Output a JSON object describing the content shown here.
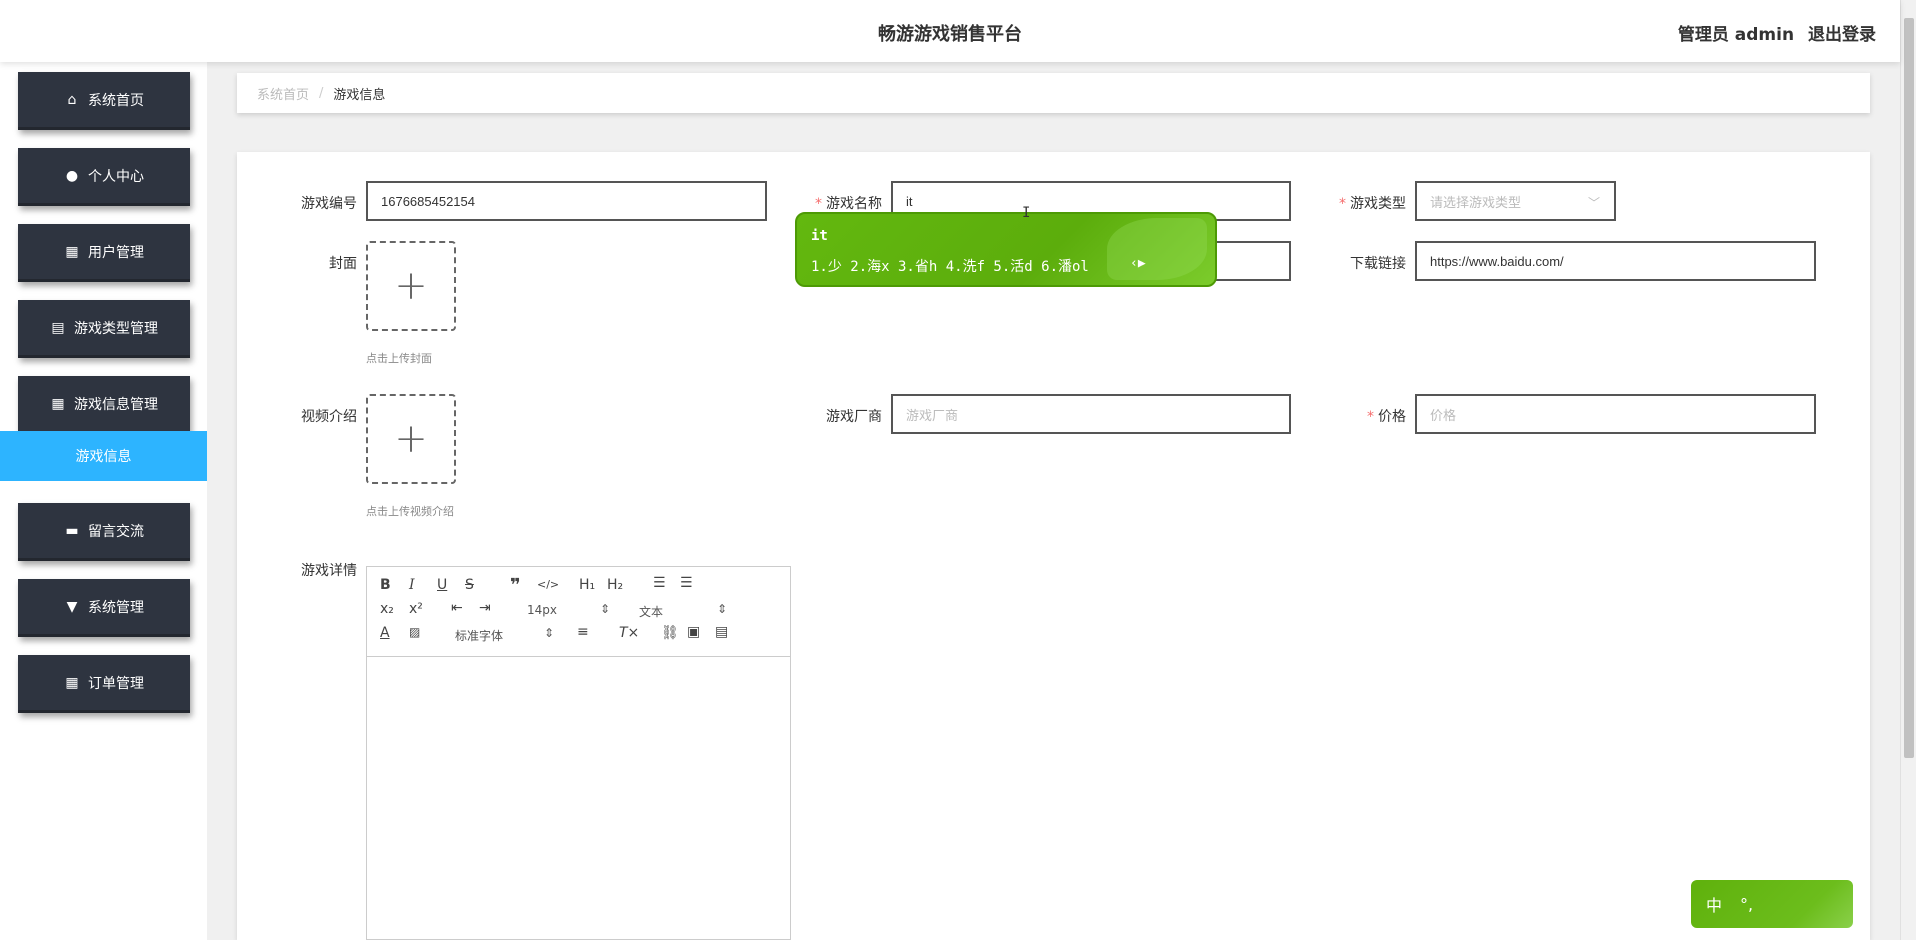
{
  "header": {
    "title": "畅游游戏销售平台",
    "user_label": "管理员 admin",
    "logout_label": "退出登录"
  },
  "sidebar": {
    "items": [
      {
        "label": "系统首页",
        "icon": "home-icon"
      },
      {
        "label": "个人中心",
        "icon": "user-icon"
      },
      {
        "label": "用户管理",
        "icon": "grid-icon"
      },
      {
        "label": "游戏类型管理",
        "icon": "clipboard-icon"
      },
      {
        "label": "游戏信息管理",
        "icon": "table-icon"
      },
      {
        "label": "留言交流",
        "icon": "chat-icon"
      },
      {
        "label": "系统管理",
        "icon": "settings-icon"
      },
      {
        "label": "订单管理",
        "icon": "grid-icon"
      }
    ],
    "active_sub": "游戏信息"
  },
  "breadcrumb": {
    "home": "系统首页",
    "separator": "/",
    "current": "游戏信息"
  },
  "form": {
    "game_no": {
      "label": "游戏编号",
      "value": "1676685452154"
    },
    "game_name": {
      "label": "游戏名称",
      "value": "it"
    },
    "game_type": {
      "label": "游戏类型",
      "placeholder": "请选择游戏类型"
    },
    "cover": {
      "label": "封面",
      "hint": "点击上传封面"
    },
    "download": {
      "label": "下载链接",
      "value": "https://www.baidu.com/"
    },
    "video": {
      "label": "视频介绍",
      "hint": "点击上传视频介绍"
    },
    "vendor": {
      "label": "游戏厂商",
      "placeholder": "游戏厂商"
    },
    "price": {
      "label": "价格",
      "placeholder": "价格"
    },
    "detail": {
      "label": "游戏详情"
    }
  },
  "editor": {
    "font_size": "14px",
    "text_style": "文本",
    "font_family": "标准字体"
  },
  "ime": {
    "composition": "it",
    "candidates": "1.少 2.海x 3.省h 4.洗f 5.活d 6.潘ol",
    "status_mode": "中",
    "status_punct": "°,"
  },
  "colors": {
    "sidebar_bg": "#2e3440",
    "active_sub_bg": "#2db4ff",
    "required": "#f56c6c",
    "ime_green": "#5fb10c"
  }
}
